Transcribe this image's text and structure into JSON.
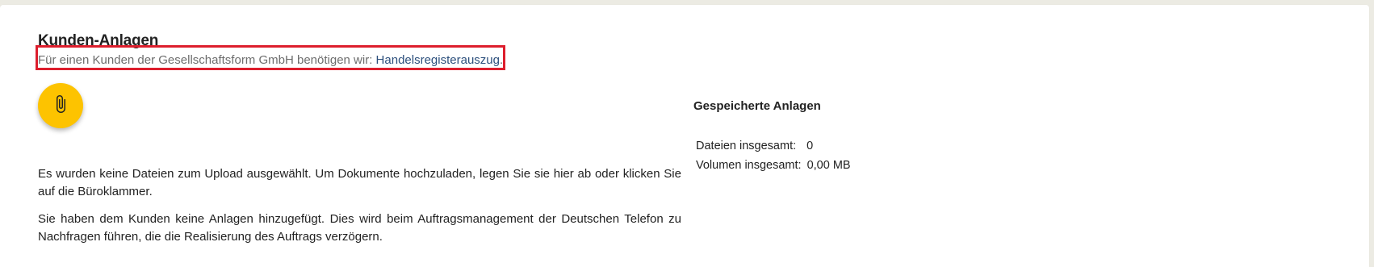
{
  "section": {
    "title": "Kunden-Anlagen",
    "requirement_prefix": "Für einen Kunden der Gesellschaftsform GmbH benötigen wir: ",
    "requirement_link": "Handelsregisterauszug",
    "requirement_suffix": "."
  },
  "upload": {
    "attach_icon": "paperclip-icon",
    "no_files_text": "Es wurden keine Dateien zum Upload ausgewählt. Um Dokumente hochzuladen, legen Sie sie hier ab oder klicken Sie auf die Büroklammer.",
    "no_attachments_warning": "Sie haben dem Kunden keine Anlagen hinzugefügt. Dies wird beim Auftragsmanagement der Deutschen Telefon zu Nachfragen führen, die die Realisierung des Auftrags verzögern."
  },
  "stored": {
    "heading": "Gespeicherte Anlagen",
    "files_label": "Dateien insgesamt:",
    "files_value": "0",
    "volume_label": "Volumen insgesamt:",
    "volume_value": "0,00 MB"
  },
  "colors": {
    "accent_yellow": "#fdc300",
    "highlight_red": "#dd1e2d",
    "link_blue": "#2c4f7c"
  }
}
